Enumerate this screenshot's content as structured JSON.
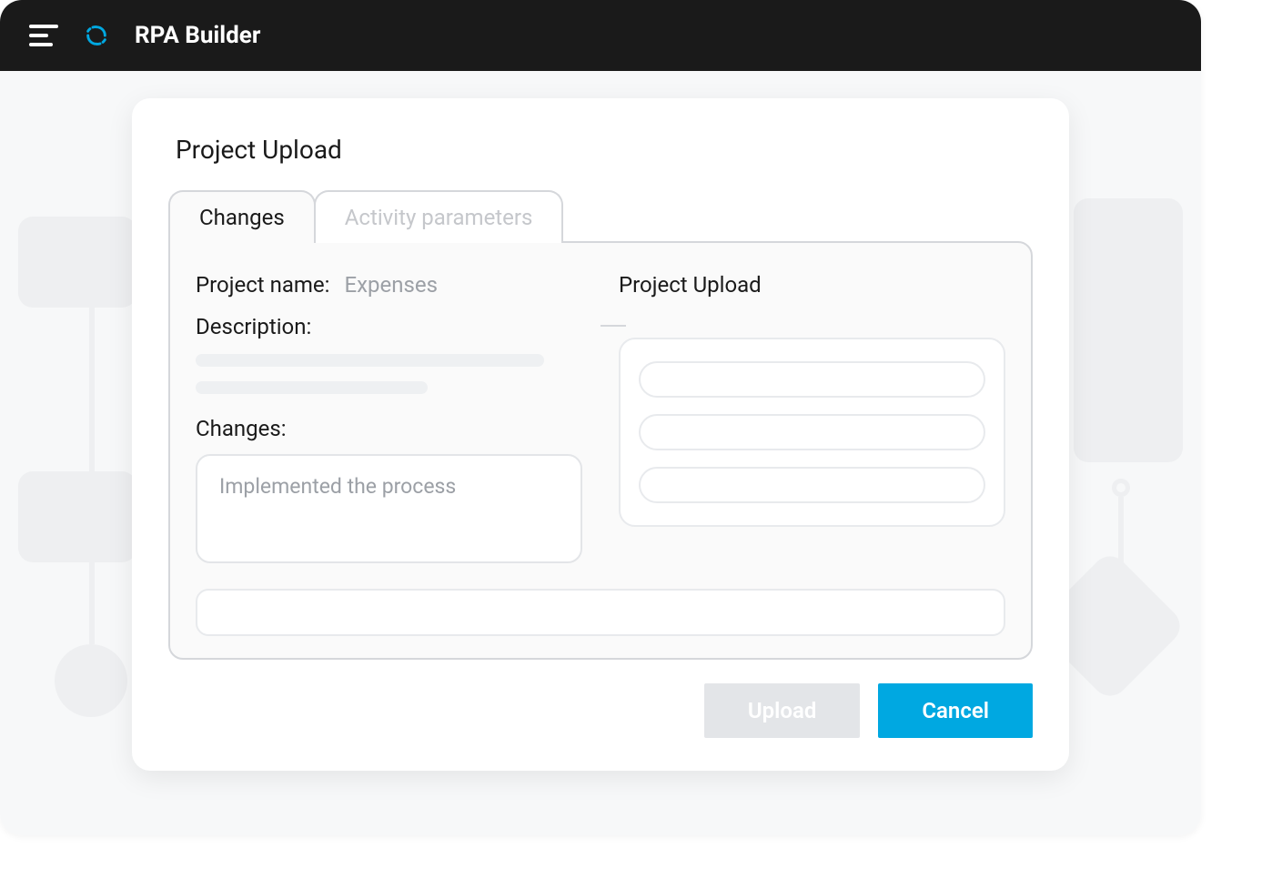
{
  "header": {
    "app_title": "RPA Builder"
  },
  "dialog": {
    "title": "Project Upload",
    "tabs": {
      "changes": "Changes",
      "activity_parameters": "Activity parameters"
    },
    "project_name_label": "Project name:",
    "project_name_value": "Expenses",
    "description_label": "Description:",
    "changes_label": "Changes:",
    "changes_value": "Implemented the process",
    "right_title": "Project Upload",
    "actions": {
      "upload": "Upload",
      "cancel": "Cancel"
    }
  },
  "colors": {
    "accent": "#00a8e1",
    "header_bg": "#1a1a1a",
    "muted": "#9ca0a6"
  }
}
